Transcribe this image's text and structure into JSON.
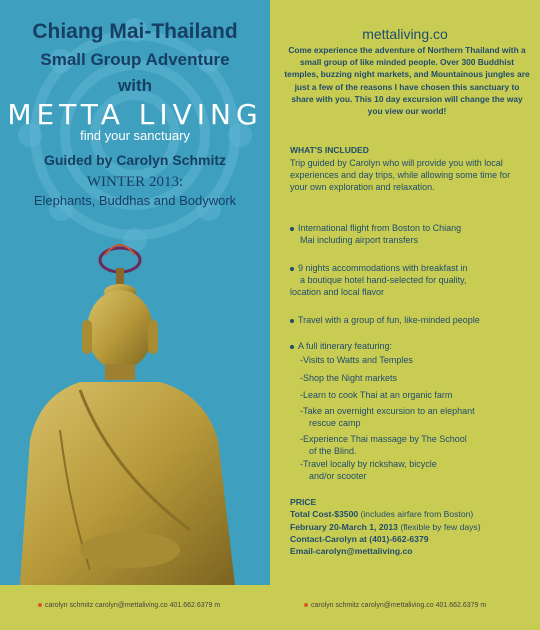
{
  "left": {
    "title_line1": "Chiang Mai-Thailand",
    "title_line2": "Small Group Adventure",
    "title_line3": "with",
    "logo": "METTA LIVING",
    "tagline": "find your sanctuary",
    "guided_by": "Guided by Carolyn Schmitz",
    "season": "WINTER 2013:",
    "theme": "Elephants, Buddhas and Bodywork",
    "footer": "carolyn schmitz   carolyn@mettaliving.co   401.662.6379 m"
  },
  "right": {
    "website": "mettaliving.co",
    "intro": "Come experience the adventure of Northern Thailand with a small group of like minded people. Over 300 Buddhist temples, buzzing night markets, and Mountainous jungles are just a few of the reasons I have chosen this sanctuary to share with you. This 10 day excursion will change the way you view our world!",
    "included_heading": "WHAT'S INCLUDED",
    "included_text": "Trip guided by Carolyn who will provide you with local experiences and day trips, while allowing some time for your own exploration and relaxation.",
    "bullets": [
      {
        "line1": "International flight from Boston to Chiang",
        "line2": "Mai including airport transfers"
      },
      {
        "line1": "9 nights accommodations with breakfast in",
        "line2": "a boutique hotel hand-selected  for quality,",
        "line3": "location and local flavor"
      },
      {
        "line1": "Travel with a group of fun, like-minded people"
      },
      {
        "line1": "A full itinerary featuring:"
      }
    ],
    "itinerary": [
      {
        "line1": "-Visits to Watts and Temples"
      },
      {
        "line1": "-Shop the Night markets"
      },
      {
        "line1": "-Learn to cook Thai at an organic farm"
      },
      {
        "line1": "-Take an overnight excursion to an elephant",
        "line2": "rescue camp"
      },
      {
        "line1": "-Experience Thai massage by The School",
        "line2": "of the Blind."
      },
      {
        "line1": "-Travel locally by rickshaw, bicycle",
        "line2": "and/or scooter"
      }
    ],
    "price_heading": "PRICE",
    "price_cost": "Total Cost-$3500",
    "price_cost_note": " (includes airfare from Boston)",
    "price_dates": "February 20-March 1, 2013",
    "price_dates_note": " (flexible by few days)",
    "contact_phone": "Contact-Carolyn at (401)-662-6379",
    "contact_email": "Email-carolyn@mettaliving.co",
    "footer": "carolyn schmitz   carolyn@mettaliving.co   401.662.6379 m"
  },
  "colors": {
    "left_bg": "#3e9fbf",
    "right_bg": "#c9cc52",
    "heading_navy": "#163f63",
    "text_navy": "#1f4d6e",
    "footer_dot": "#d85a2a",
    "buddha_gold": "#b89a3a"
  },
  "icons": [
    "mandala-ornament-icon",
    "buddha-statue-image",
    "footer-dot-icon",
    "bullet-dot-icon"
  ]
}
